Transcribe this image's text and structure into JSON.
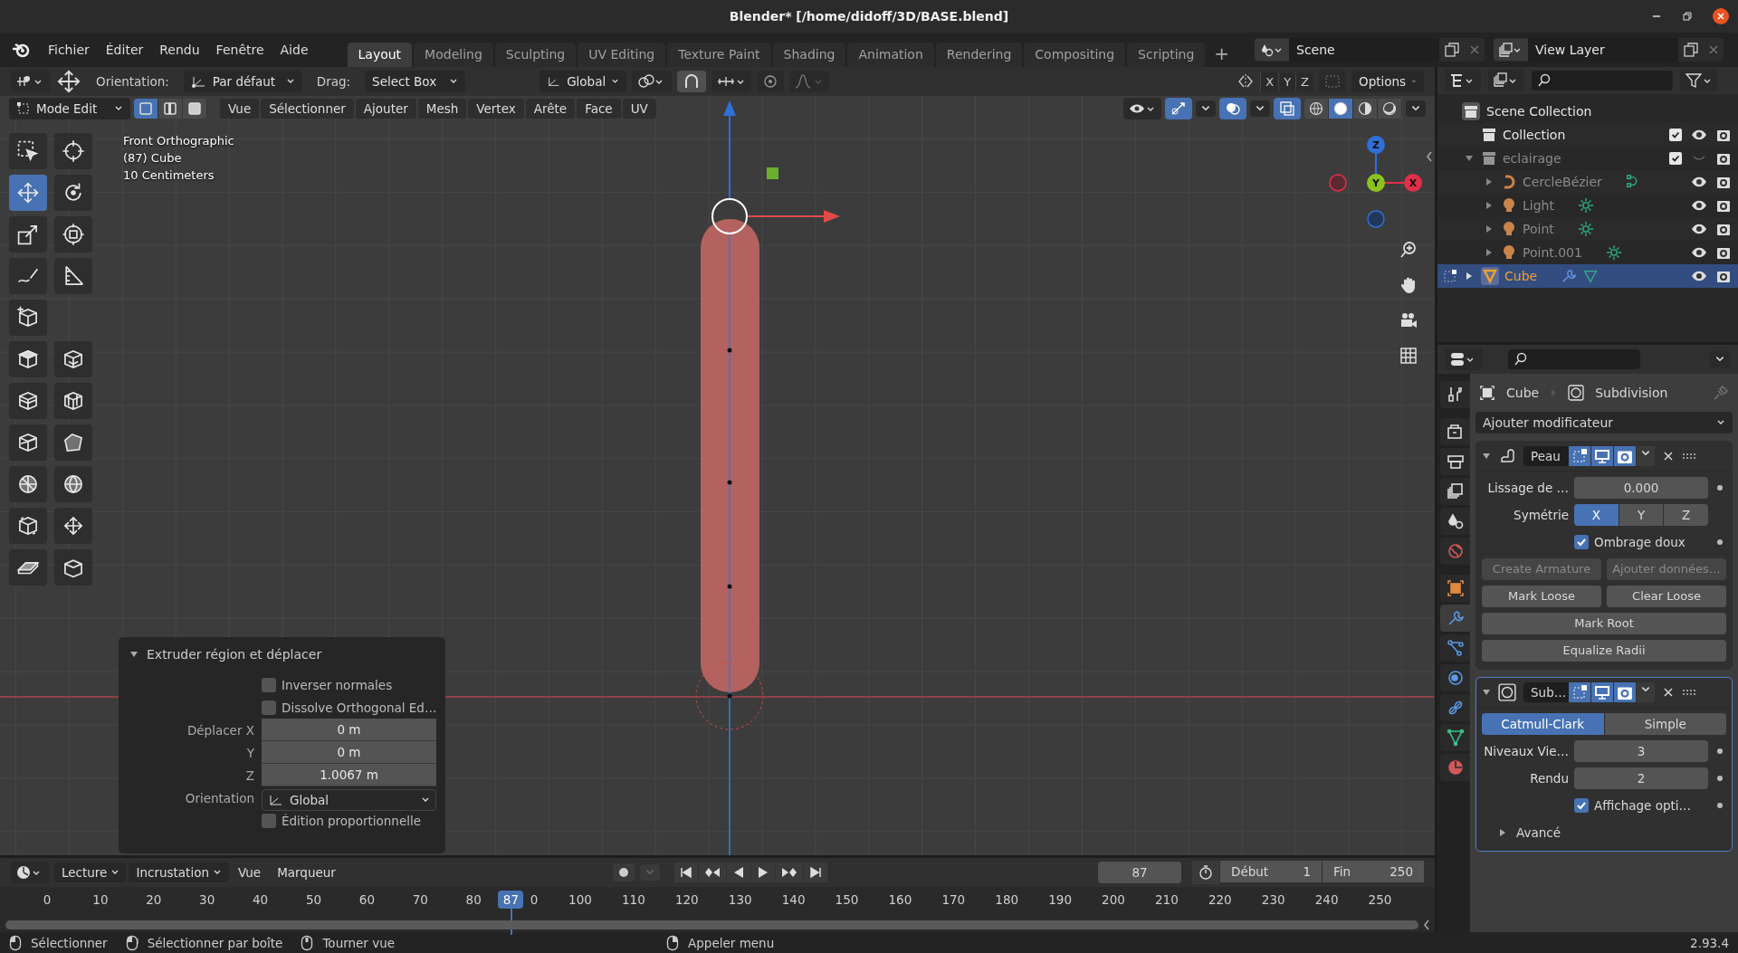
{
  "window": {
    "title": "Blender* [/home/didoff/3D/BASE.blend]"
  },
  "menu": [
    "Fichier",
    "Éditer",
    "Rendu",
    "Fenêtre",
    "Aide"
  ],
  "workspaces": [
    {
      "label": "Layout",
      "selected": true
    },
    {
      "label": "Modeling",
      "selected": false
    },
    {
      "label": "Sculpting",
      "selected": false
    },
    {
      "label": "UV Editing",
      "selected": false
    },
    {
      "label": "Texture Paint",
      "selected": false
    },
    {
      "label": "Shading",
      "selected": false
    },
    {
      "label": "Animation",
      "selected": false
    },
    {
      "label": "Rendering",
      "selected": false
    },
    {
      "label": "Compositing",
      "selected": false
    },
    {
      "label": "Scripting",
      "selected": false
    }
  ],
  "add_workspace": "+",
  "scene": "Scene",
  "view_layer": "View Layer",
  "tool_header": {
    "orientation_label": "Orientation:",
    "orientation": "Par défaut",
    "drag_label": "Drag:",
    "drag": "Select Box",
    "transform": "Global",
    "axes": [
      "X",
      "Y",
      "Z"
    ],
    "options": "Options"
  },
  "view_header": {
    "mode": "Mode Edit",
    "select_modes": [
      {
        "kind": "vertex",
        "selected": true
      },
      {
        "kind": "edge",
        "selected": false
      },
      {
        "kind": "face",
        "selected": false
      }
    ],
    "menus": [
      "Vue",
      "Sélectionner",
      "Ajouter",
      "Mesh",
      "Vertex",
      "Arête",
      "Face",
      "UV"
    ],
    "shading": [
      {
        "kind": "wireframe",
        "selected": false
      },
      {
        "kind": "solid",
        "selected": true
      },
      {
        "kind": "material",
        "selected": false
      },
      {
        "kind": "rendered",
        "selected": false
      }
    ]
  },
  "viewport": {
    "info": [
      "Front Orthographic",
      "(87) Cube",
      "10 Centimeters"
    ],
    "tool_rows": [
      [
        {
          "kind": "select-box",
          "selected": false
        },
        {
          "kind": "cursor",
          "selected": false
        }
      ],
      [
        {
          "kind": "move",
          "selected": true
        },
        {
          "kind": "rotate",
          "selected": false
        }
      ],
      [
        {
          "kind": "scale",
          "selected": false
        },
        {
          "kind": "transform",
          "selected": false
        }
      ],
      [
        {
          "kind": "annotate",
          "selected": false
        },
        {
          "kind": "measure",
          "selected": false
        }
      ],
      [
        {
          "kind": "add-cube",
          "selected": false
        }
      ],
      [
        {
          "kind": "extrude",
          "selected": false
        },
        {
          "kind": "inset",
          "selected": false
        }
      ],
      [
        {
          "kind": "bevel",
          "selected": false
        },
        {
          "kind": "loop-cut",
          "selected": false
        }
      ],
      [
        {
          "kind": "knife",
          "selected": false
        },
        {
          "kind": "poly-build",
          "selected": false
        }
      ],
      [
        {
          "kind": "spin",
          "selected": false
        },
        {
          "kind": "smooth",
          "selected": false
        }
      ],
      [
        {
          "kind": "edge-slide",
          "selected": false
        },
        {
          "kind": "shrink",
          "selected": false
        }
      ],
      [
        {
          "kind": "shear",
          "selected": false
        },
        {
          "kind": "rip",
          "selected": false
        }
      ]
    ],
    "nav_axes": [
      {
        "label": "Z",
        "color": "#2f6fd6"
      },
      {
        "label": "Y",
        "color": "#8bc21c"
      },
      {
        "label": "X",
        "color": "#e0304a"
      }
    ]
  },
  "operator_panel": {
    "title": "Extruder région et déplacer",
    "expanded": true,
    "rows": [
      {
        "kind": "checkbox",
        "label": "Inverser normales",
        "checked": false
      },
      {
        "kind": "checkbox",
        "label": "Dissolve Orthogonal Ed…",
        "checked": false
      },
      {
        "kind": "number",
        "label": "Déplacer X",
        "value": "0 m"
      },
      {
        "kind": "number",
        "label": "Y",
        "value": "0 m"
      },
      {
        "kind": "number",
        "label": "Z",
        "value": "1.0067 m"
      },
      {
        "kind": "dropdown",
        "label": "Orientation",
        "value": "Global"
      },
      {
        "kind": "checkbox",
        "label": "Édition proportionnelle",
        "checked": false
      }
    ]
  },
  "outliner": {
    "root": {
      "name": "Scene Collection",
      "children": [
        {
          "kind": "collection",
          "name": "Collection",
          "checked": true,
          "visible": true,
          "selected": false
        },
        {
          "kind": "collection",
          "name": "eclairage",
          "checked": true,
          "visible": false,
          "selected": false,
          "expanded": true,
          "children": [
            {
              "kind": "curve",
              "name": "CercleBézier",
              "visible": true,
              "selected": false,
              "expanded": false
            },
            {
              "kind": "light",
              "name": "Light",
              "visible": true,
              "selected": false,
              "expanded": false
            },
            {
              "kind": "light",
              "name": "Point",
              "visible": true,
              "selected": false,
              "expanded": false
            },
            {
              "kind": "light",
              "name": "Point.001",
              "visible": true,
              "selected": false,
              "expanded": false
            }
          ]
        },
        {
          "kind": "mesh",
          "name": "Cube",
          "visible": true,
          "selected": true,
          "expanded": false
        }
      ]
    }
  },
  "properties": {
    "tabs": [
      {
        "kind": "tool",
        "selected": false
      },
      {
        "kind": "render",
        "selected": false
      },
      {
        "kind": "output",
        "selected": false
      },
      {
        "kind": "view-layer",
        "selected": false
      },
      {
        "kind": "scene",
        "selected": false
      },
      {
        "kind": "world",
        "selected": false
      },
      {
        "kind": "object",
        "selected": false
      },
      {
        "kind": "modifier",
        "selected": true
      },
      {
        "kind": "particles",
        "selected": false
      },
      {
        "kind": "physics",
        "selected": false
      },
      {
        "kind": "constraints",
        "selected": false
      },
      {
        "kind": "data",
        "selected": false
      },
      {
        "kind": "material",
        "selected": false
      }
    ],
    "breadcrumb": [
      "Cube",
      "Subdivision"
    ],
    "add_modifier": "Ajouter modificateur",
    "modifiers": [
      {
        "kind": "skin",
        "name": "Peau",
        "expanded": true,
        "active": false,
        "edit_mode": true,
        "viewport": true,
        "render": true,
        "rows": [
          {
            "kind": "number",
            "label": "Lissage de …",
            "value": "0.000"
          },
          {
            "kind": "segmented",
            "label": "Symétrie",
            "options": [
              {
                "label": "X",
                "selected": true
              },
              {
                "label": "Y",
                "selected": false
              },
              {
                "label": "Z",
                "selected": false
              }
            ]
          },
          {
            "kind": "checkbox",
            "label": "Ombrage doux",
            "checked": true
          },
          {
            "kind": "buttons",
            "buttons": [
              {
                "label": "Create Armature",
                "disabled": true
              },
              {
                "label": "Ajouter données…",
                "disabled": true
              }
            ]
          },
          {
            "kind": "buttons",
            "buttons": [
              {
                "label": "Mark Loose",
                "disabled": false
              },
              {
                "label": "Clear Loose",
                "disabled": false
              }
            ]
          },
          {
            "kind": "buttons",
            "buttons": [
              {
                "label": "Mark Root",
                "disabled": false
              }
            ]
          },
          {
            "kind": "buttons",
            "buttons": [
              {
                "label": "Equalize Radii",
                "disabled": false
              }
            ]
          }
        ]
      },
      {
        "kind": "subdivision",
        "name": "Sub…",
        "expanded": true,
        "active": true,
        "edit_mode": true,
        "viewport": true,
        "render": true,
        "rows": [
          {
            "kind": "segmented",
            "options": [
              {
                "label": "Catmull-Clark",
                "selected": true
              },
              {
                "label": "Simple",
                "selected": false
              }
            ]
          },
          {
            "kind": "number",
            "label": "Niveaux Vie…",
            "value": "3"
          },
          {
            "kind": "number",
            "label": "Rendu",
            "value": "2"
          },
          {
            "kind": "checkbox",
            "label": "Affichage opti…",
            "checked": true
          },
          {
            "kind": "subpanel",
            "label": "Avancé",
            "expanded": false
          }
        ]
      }
    ]
  },
  "timeline": {
    "menus": [
      {
        "kind": "dropdown",
        "label": "Lecture"
      },
      {
        "kind": "dropdown",
        "label": "Incrustation"
      },
      {
        "kind": "menu",
        "label": "Vue"
      },
      {
        "kind": "menu",
        "label": "Marqueur"
      }
    ],
    "current_frame": "87",
    "start_label": "Début",
    "start": "1",
    "end_label": "Fin",
    "end": "250",
    "playhead": "87",
    "ticks": [
      "0",
      "10",
      "20",
      "30",
      "40",
      "50",
      "60",
      "70",
      "80",
      "0",
      "100",
      "110",
      "120",
      "130",
      "140",
      "150",
      "160",
      "170",
      "180",
      "190",
      "200",
      "210",
      "220",
      "230",
      "240",
      "250"
    ]
  },
  "status_bar": {
    "hints": [
      {
        "kind": "left",
        "label": "Sélectionner"
      },
      {
        "kind": "drag",
        "label": "Sélectionner par boîte"
      },
      {
        "kind": "middle",
        "label": "Tourner vue"
      },
      {
        "kind": "right",
        "label": "Appeler menu"
      }
    ],
    "version": "2.93.4"
  }
}
